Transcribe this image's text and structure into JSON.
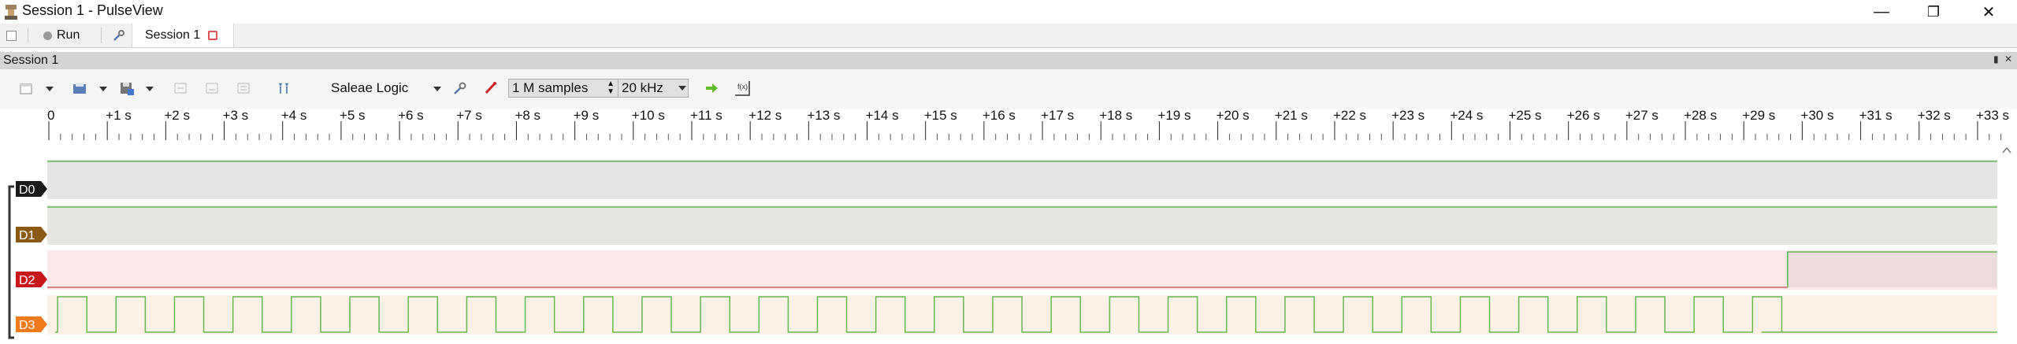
{
  "window": {
    "title": "Session 1 - PulseView"
  },
  "tabs": {
    "run_label": "Run",
    "session_tab": "Session 1"
  },
  "dock": {
    "title": "Session 1"
  },
  "toolbar": {
    "device": "Saleae Logic",
    "samples": "1 M samples",
    "rate": "20 kHz"
  },
  "ruler": {
    "labels": [
      "0",
      "+1 s",
      "+2 s",
      "+3 s",
      "+4 s",
      "+5 s",
      "+6 s",
      "+7 s",
      "+8 s",
      "+9 s",
      "+10 s",
      "+11 s",
      "+12 s",
      "+13 s",
      "+14 s",
      "+15 s",
      "+16 s",
      "+17 s",
      "+18 s",
      "+19 s",
      "+20 s",
      "+21 s",
      "+22 s",
      "+23 s",
      "+24 s",
      "+25 s",
      "+26 s",
      "+27 s",
      "+28 s",
      "+29 s",
      "+30 s",
      "+31 s",
      "+32 s",
      "+33 s"
    ],
    "minor_per_major": 5
  },
  "channels": [
    {
      "name": "D0",
      "label_color": "#1a1a1a",
      "band_color": "#e5e5e5",
      "signal": "high"
    },
    {
      "name": "D1",
      "label_color": "#8b5a14",
      "band_color": "#e8e6e0",
      "signal": "high"
    },
    {
      "name": "D2",
      "label_color": "#c8161d",
      "band_color": "#fae8e8",
      "signal": "low-then-high",
      "rise_seconds": 29.75
    },
    {
      "name": "D3",
      "label_color": "#ee7a1a",
      "band_color": "#fdf1e6",
      "signal": "clock",
      "period_seconds": 1.0,
      "high_fraction": 0.5,
      "first_rise_seconds": 0.15,
      "stop_seconds": 29.3
    }
  ],
  "colors": {
    "signal": "#5fbb4f",
    "d2_low_signal": "#d06060",
    "accent": "#2f7ad6"
  }
}
